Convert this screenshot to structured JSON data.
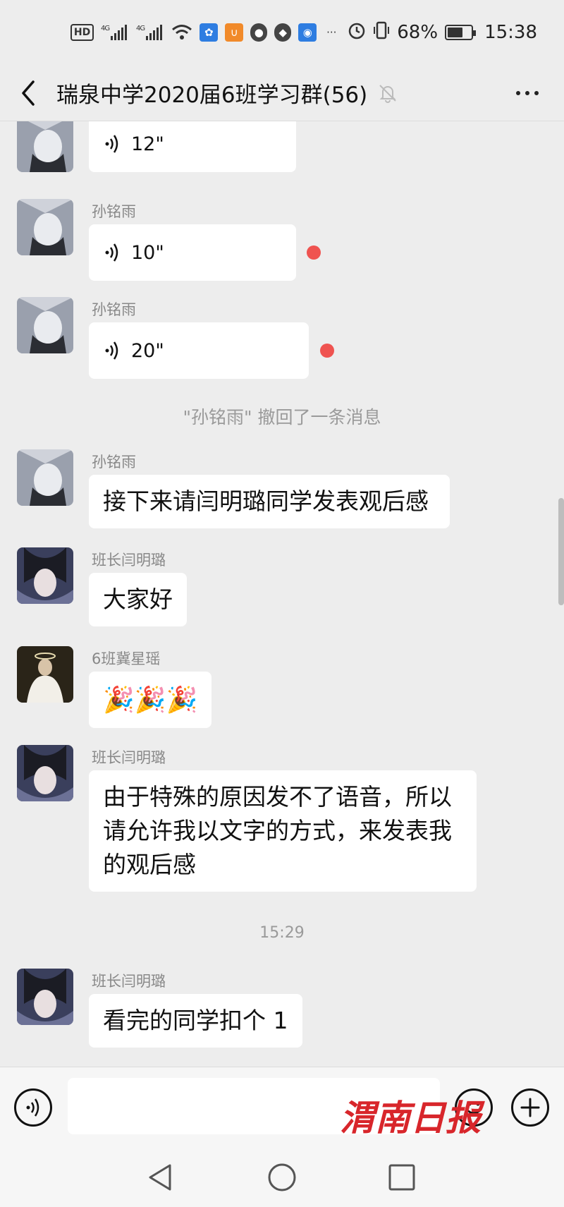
{
  "status_bar": {
    "hd": "HD",
    "net1": "4G",
    "net2": "4G",
    "battery_percent": "68%",
    "battery_level": 0.68,
    "time": "15:38",
    "icons": [
      "hd-icon",
      "signal-icon",
      "signal-icon",
      "wifi-icon",
      "baidu-app-icon",
      "uc-browser-icon",
      "qq-icon",
      "shield-app-icon",
      "app-icon",
      "more-dots-icon",
      "alarm-icon",
      "vibrate-icon",
      "battery-icon"
    ]
  },
  "header": {
    "title": "瑞泉中学2020届6班学习群(56)",
    "icons": [
      "back-arrow-icon",
      "mute-bell-icon",
      "more-icon"
    ]
  },
  "messages": [
    {
      "type": "voice",
      "sender": "",
      "duration": "12\"",
      "unread": false
    },
    {
      "type": "voice",
      "sender": "孙铭雨",
      "duration": "10\"",
      "unread": true
    },
    {
      "type": "voice",
      "sender": "孙铭雨",
      "duration": "20\"",
      "unread": true
    },
    {
      "type": "system",
      "text": "\"孙铭雨\" 撤回了一条消息"
    },
    {
      "type": "text",
      "sender": "孙铭雨",
      "text": "接下来请闫明璐同学发表观后感"
    },
    {
      "type": "text",
      "sender": "班长闫明璐",
      "text": "大家好"
    },
    {
      "type": "emoji",
      "sender": "6班冀星瑶",
      "text": "🎉🎉🎉"
    },
    {
      "type": "text",
      "sender": "班长闫明璐",
      "lines": [
        "由于特殊的原因发不了语音，所以",
        "请允许我以文字的方式，来发表我",
        "的观后感"
      ]
    },
    {
      "type": "time",
      "text": "15:29"
    },
    {
      "type": "text",
      "sender": "班长闫明璐",
      "text": "看完的同学扣个 1"
    }
  ],
  "input_bar": {
    "placeholder": "",
    "icons": [
      "voice-input-icon",
      "emoji-icon",
      "plus-icon"
    ]
  },
  "nav_bar": {
    "icons": [
      "nav-back-icon",
      "nav-home-icon",
      "nav-recents-icon"
    ]
  },
  "watermark": {
    "text": "渭南日报"
  },
  "colors": {
    "background": "#ededed",
    "bubble": "#ffffff",
    "unread_dot": "#ef5350",
    "watermark": "#d8262b"
  }
}
